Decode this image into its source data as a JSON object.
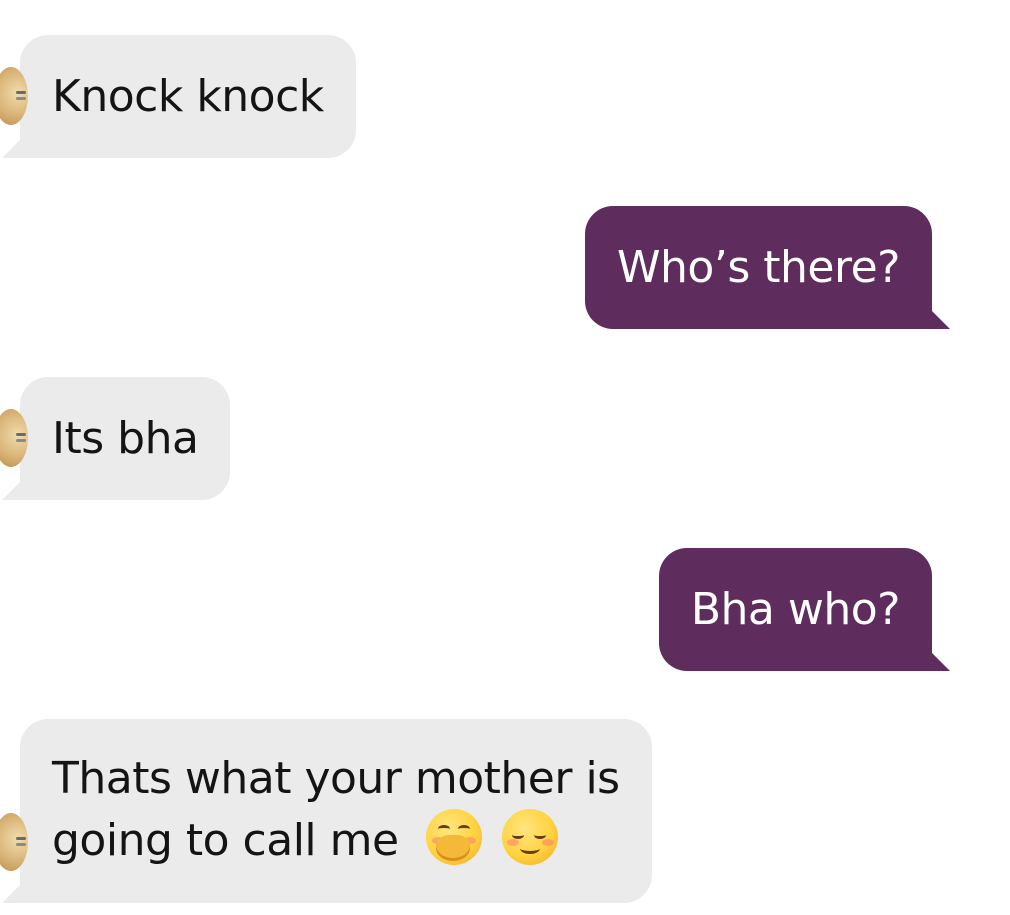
{
  "messages": [
    {
      "side": "incoming",
      "text": "Knock knock"
    },
    {
      "side": "outgoing",
      "text": "Who’s there?"
    },
    {
      "side": "incoming",
      "text": "Its bha"
    },
    {
      "side": "outgoing",
      "text": "Bha who?"
    },
    {
      "side": "incoming",
      "line1": "Thats what your mother is",
      "line2": "going to call me",
      "emojis": [
        "face-with-hand-over-mouth-emoji",
        "relieved-face-emoji"
      ]
    }
  ],
  "colors": {
    "incoming_bubble": "#ebebeb",
    "outgoing_bubble": "#5e2c5d",
    "incoming_text": "#141414",
    "outgoing_text": "#ffffff"
  }
}
